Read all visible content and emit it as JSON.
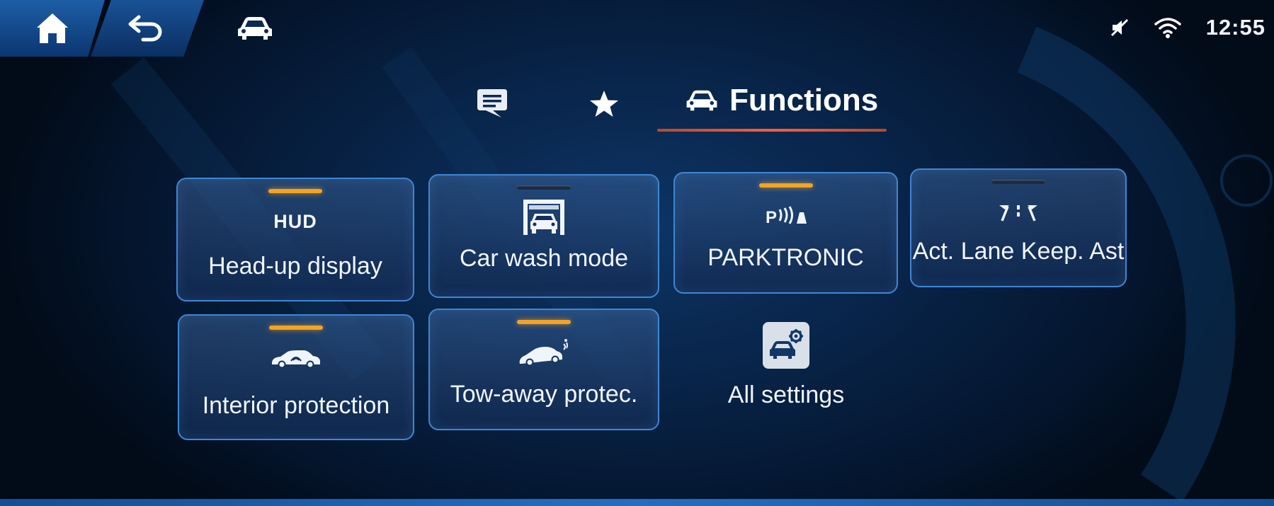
{
  "topbar": {
    "home_icon": "home-icon",
    "back_icon": "back-arrow-icon",
    "car_icon": "car-icon",
    "status": {
      "mute_icon": "mute-icon",
      "wifi_icon": "wifi-icon",
      "time": "12:55"
    }
  },
  "tabs": {
    "items": [
      {
        "icon": "message-icon",
        "label": ""
      },
      {
        "icon": "star-icon",
        "label": ""
      },
      {
        "icon": "car-icon",
        "label": "Functions",
        "active": true
      }
    ]
  },
  "tiles": [
    {
      "label": "Head-up display",
      "icon_text": "HUD",
      "indicator": "on"
    },
    {
      "label": "Car wash mode",
      "icon": "car-wash-icon",
      "indicator": "off"
    },
    {
      "label": "PARKTRONIC",
      "icon": "parktronic-icon",
      "indicator": "on"
    },
    {
      "label": "Act. Lane Keep. Ast",
      "icon": "lane-keep-icon",
      "indicator": "off"
    },
    {
      "label": "Interior protection",
      "icon": "interior-protection-icon",
      "indicator": "on"
    },
    {
      "label": "Tow-away protec.",
      "icon": "tow-away-icon",
      "indicator": "on"
    }
  ],
  "all_settings": {
    "label": "All settings",
    "icon": "car-settings-icon"
  },
  "colors": {
    "accent_underline": "#ff5d34",
    "indicator_on": "#f5a321",
    "tile_border": "#3f86d4"
  }
}
